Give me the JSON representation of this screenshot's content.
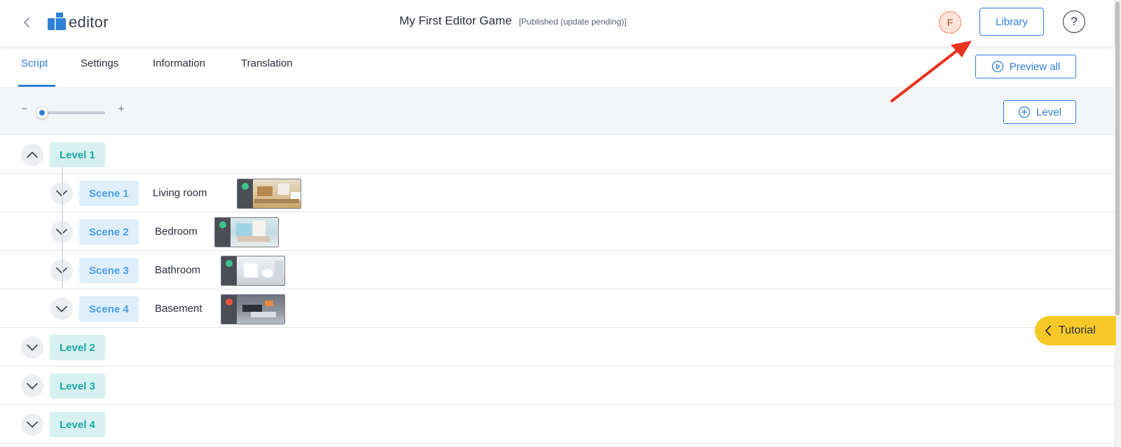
{
  "header": {
    "logo_text": "editor",
    "game_title": "My First Editor Game",
    "publish_status": "[Published (update pending)]",
    "avatar_initial": "F",
    "library_label": "Library",
    "help_label": "?"
  },
  "tabs": [
    {
      "label": "Script",
      "active": true
    },
    {
      "label": "Settings",
      "active": false
    },
    {
      "label": "Information",
      "active": false
    },
    {
      "label": "Translation",
      "active": false
    }
  ],
  "preview_all_label": "Preview all",
  "toolbar": {
    "zoom_minus": "−",
    "zoom_plus": "+",
    "zoom_level": 0.02,
    "add_level_label": "Level"
  },
  "levels": [
    {
      "label": "Level 1",
      "expanded": true,
      "scenes": [
        {
          "label": "Scene 1",
          "name": "Living room",
          "status": "green"
        },
        {
          "label": "Scene 2",
          "name": "Bedroom",
          "status": "green"
        },
        {
          "label": "Scene 3",
          "name": "Bathroom",
          "status": "green"
        },
        {
          "label": "Scene 4",
          "name": "Basement",
          "status": "red"
        }
      ]
    },
    {
      "label": "Level 2",
      "expanded": false
    },
    {
      "label": "Level 3",
      "expanded": false
    },
    {
      "label": "Level 4",
      "expanded": false
    }
  ],
  "tutorial_label": "Tutorial",
  "colors": {
    "accent_blue": "#2f7fd8",
    "level_teal": "#1aa8a6",
    "scene_blue": "#4aa0e8",
    "status_green": "#3ec28f",
    "status_red": "#e8553f",
    "tutorial_yellow": "#f6c928",
    "annotation_arrow": "#e8321e"
  }
}
